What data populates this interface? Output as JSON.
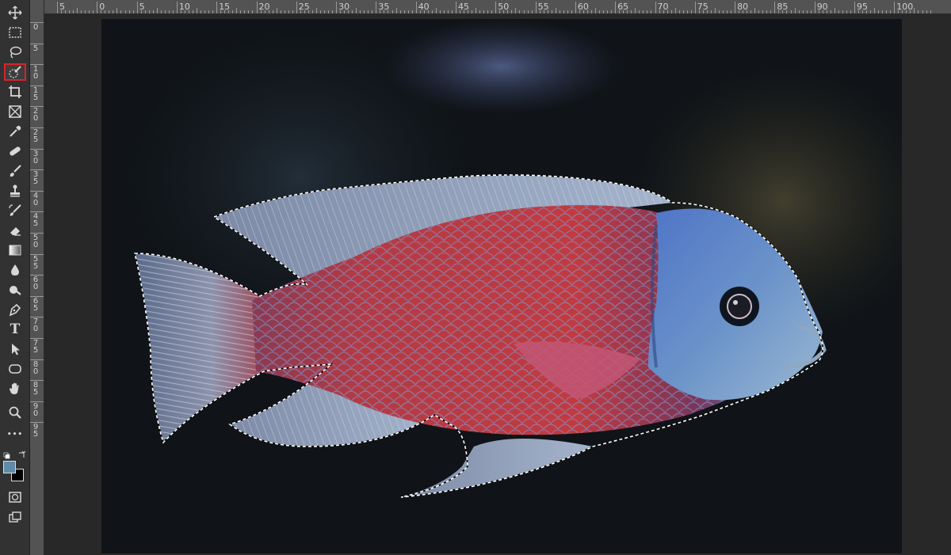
{
  "toolbar": {
    "tools": [
      {
        "name": "move-tool",
        "icon": "move-icon"
      },
      {
        "name": "marquee-tool",
        "icon": "rect-marquee-icon"
      },
      {
        "name": "lasso-tool",
        "icon": "lasso-icon"
      },
      {
        "name": "quick-selection-tool",
        "icon": "quick-select-icon",
        "active": true
      },
      {
        "name": "crop-tool",
        "icon": "crop-icon"
      },
      {
        "name": "frame-tool",
        "icon": "frame-icon"
      },
      {
        "name": "eyedropper-tool",
        "icon": "eyedropper-icon"
      },
      {
        "name": "healing-brush-tool",
        "icon": "bandage-icon"
      },
      {
        "name": "brush-tool",
        "icon": "brush-icon"
      },
      {
        "name": "clone-stamp-tool",
        "icon": "stamp-icon"
      },
      {
        "name": "history-brush-tool",
        "icon": "history-brush-icon"
      },
      {
        "name": "eraser-tool",
        "icon": "eraser-icon"
      },
      {
        "name": "gradient-tool",
        "icon": "gradient-icon"
      },
      {
        "name": "blur-tool",
        "icon": "drop-icon"
      },
      {
        "name": "dodge-tool",
        "icon": "dodge-icon"
      },
      {
        "name": "pen-tool",
        "icon": "pen-icon"
      },
      {
        "name": "type-tool",
        "icon": "type-icon",
        "glyph": "T"
      },
      {
        "name": "path-selection-tool",
        "icon": "arrow-icon"
      },
      {
        "name": "shape-tool",
        "icon": "rounded-rect-icon"
      },
      {
        "name": "hand-tool",
        "icon": "hand-icon"
      },
      {
        "name": "zoom-tool",
        "icon": "magnifier-icon"
      },
      {
        "name": "edit-toolbar",
        "icon": "more-icon",
        "glyph": "•••"
      }
    ],
    "foreground_color": "#5f8aa8",
    "background_color": "#000000"
  },
  "ruler_h": {
    "labels": [
      "5",
      "0",
      "5",
      "10",
      "15",
      "20",
      "25",
      "30",
      "35",
      "40",
      "45",
      "50",
      "55",
      "60",
      "65",
      "70",
      "75",
      "80",
      "85",
      "90",
      "95",
      "100"
    ]
  },
  "ruler_v": {
    "labels": [
      "0",
      "5",
      "1 0",
      "1 5",
      "2 0",
      "2 5",
      "3 0",
      "3 5",
      "4 0",
      "4 5",
      "5 0",
      "5 5",
      "6 0",
      "6 5",
      "7 0",
      "7 5",
      "8 0",
      "8 5",
      "9 0",
      "9 5"
    ]
  },
  "colors": {
    "accent_active": "#d8242a",
    "panel": "#323232",
    "ruler": "#535353",
    "workspace": "#282828"
  }
}
